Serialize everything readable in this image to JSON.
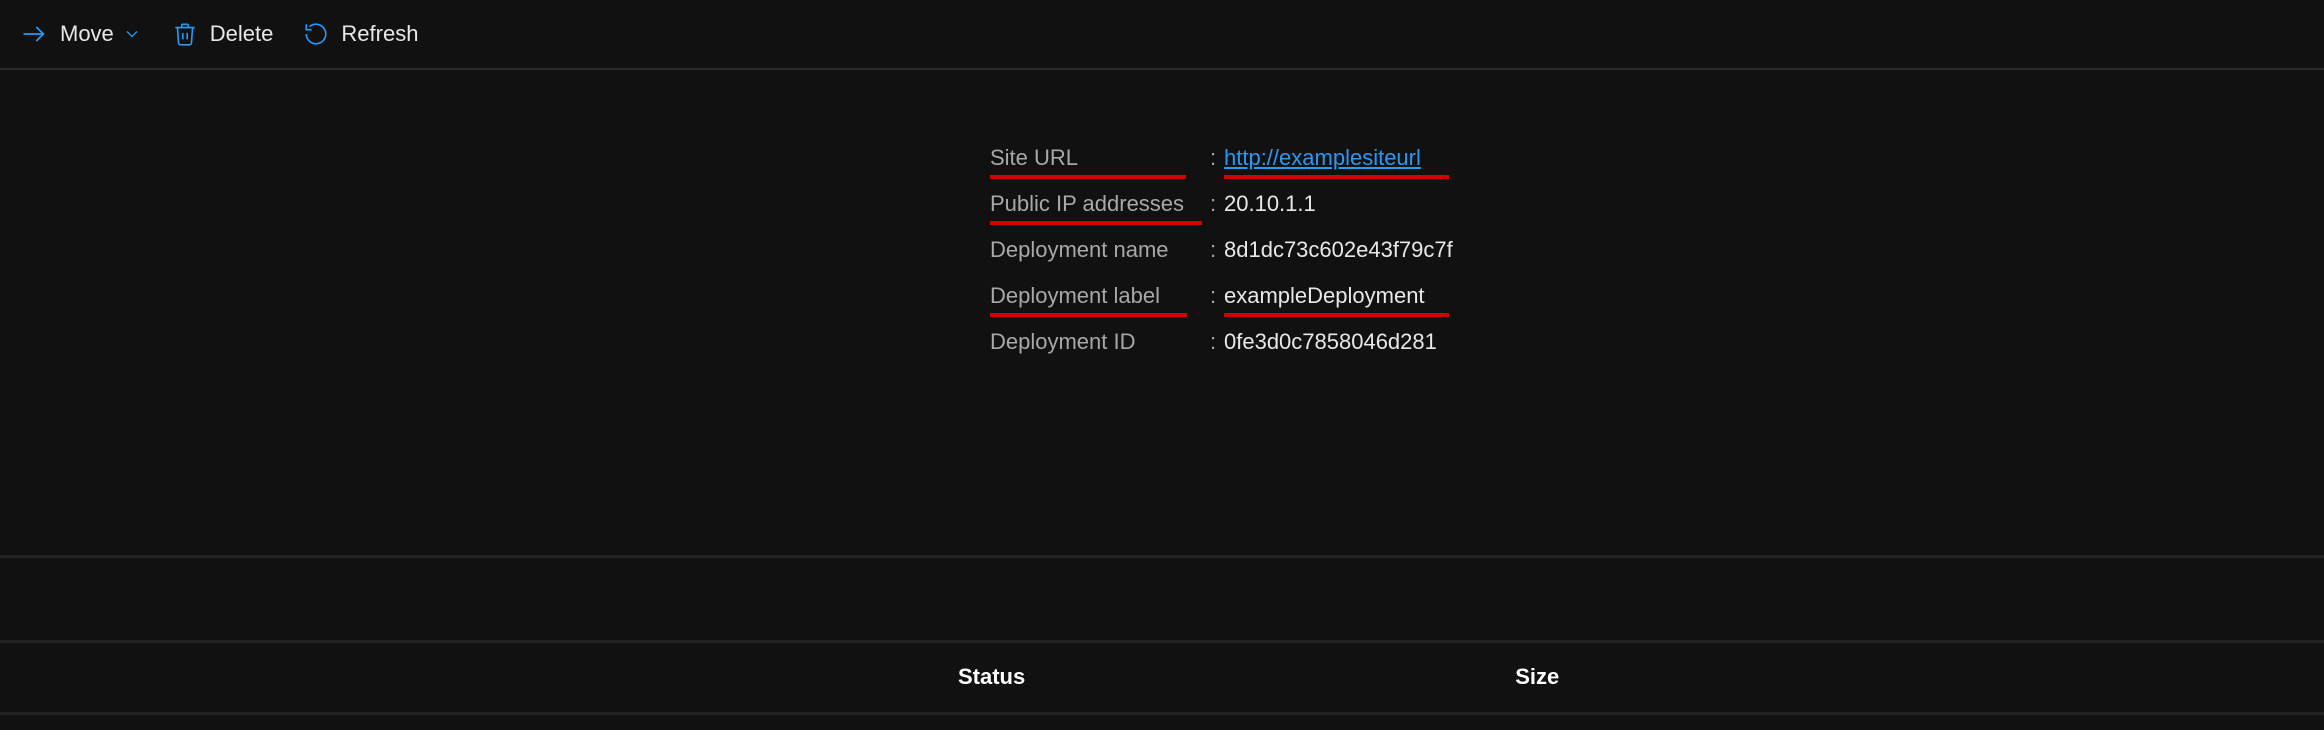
{
  "toolbar": {
    "move_label": "Move",
    "delete_label": "Delete",
    "refresh_label": "Refresh"
  },
  "properties": {
    "site_url": {
      "label": "Site URL",
      "value": "http://examplesiteurl"
    },
    "public_ip": {
      "label": "Public IP addresses",
      "value": "20.10.1.1"
    },
    "deployment_name": {
      "label": "Deployment name",
      "value": "8d1dc73c602e43f79c7f"
    },
    "deployment_label": {
      "label": "Deployment label",
      "value": "exampleDeployment"
    },
    "deployment_id": {
      "label": "Deployment ID",
      "value": "0fe3d0c7858046d281"
    }
  },
  "columns": {
    "status": "Status",
    "size": "Size"
  }
}
